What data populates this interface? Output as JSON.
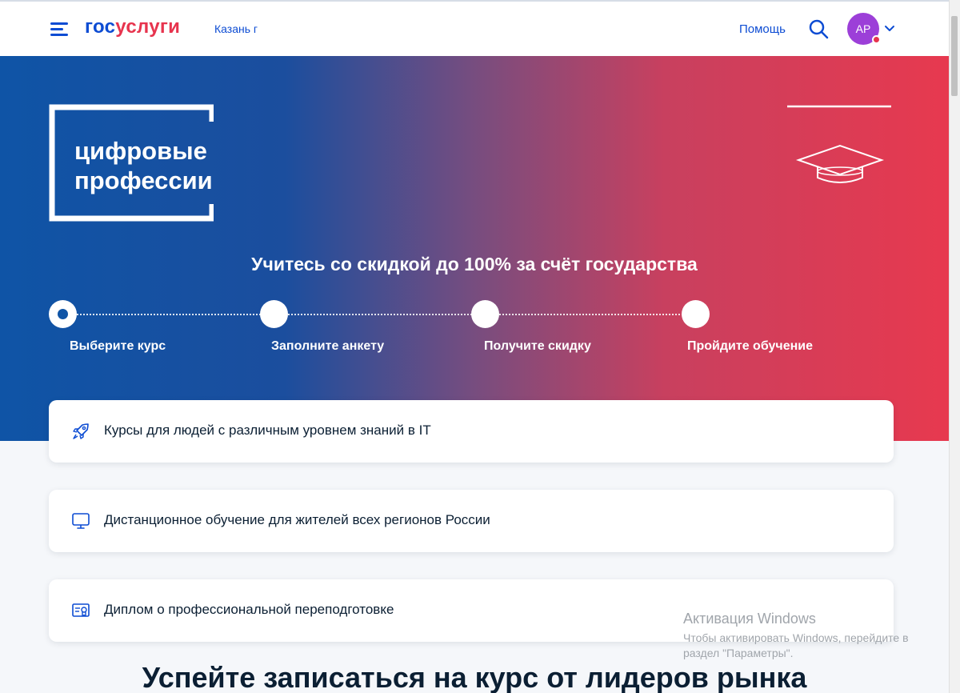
{
  "header": {
    "logo_part1": "гос",
    "logo_part2": "услуги",
    "city": "Казань г",
    "help": "Помощь",
    "avatar_initials": "АР"
  },
  "hero": {
    "logo_line1": "цифровые",
    "logo_line2": "профессии",
    "title": "Учитесь со скидкой до 100% за счёт государства",
    "steps": [
      {
        "label": "Выберите курс",
        "active": true
      },
      {
        "label": "Заполните анкету",
        "active": false
      },
      {
        "label": "Получите скидку",
        "active": false
      },
      {
        "label": "Пройдите обучение",
        "active": false
      }
    ]
  },
  "features": [
    {
      "icon": "rocket-icon",
      "text": "Курсы для людей с различным уровнем знаний в IT"
    },
    {
      "icon": "monitor-icon",
      "text": "Дистанционное обучение для жителей всех регионов России"
    },
    {
      "icon": "diploma-icon",
      "text": "Диплом о профессиональной переподготовке"
    }
  ],
  "section_title": "Успейте записаться на курс от лидеров рынка",
  "watermark": {
    "title": "Активация Windows",
    "text": "Чтобы активировать Windows, перейдите в раздел \"Параметры\"."
  },
  "colors": {
    "brand_blue": "#0d4cd3",
    "brand_red": "#e7344e",
    "hero_start": "#0f54a6",
    "hero_end": "#e7394f",
    "avatar": "#9c3fd8"
  }
}
